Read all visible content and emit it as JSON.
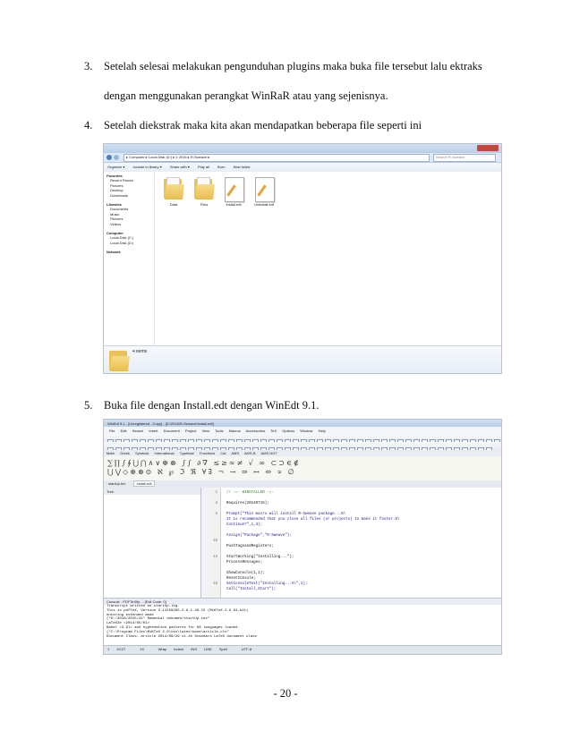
{
  "paragraphs": [
    {
      "num": "3.",
      "text": "Setelah selesai melakukan pengunduhan plugins maka buka file tersebut lalu ektraks"
    },
    {
      "num": "",
      "text": "dengan menggunakan perangkat WinRaR atau yang sejenisnya."
    },
    {
      "num": "4.",
      "text": "Setelah diekstrak maka kita akan mendapatkan beberapa file seperti ini"
    },
    {
      "num": "5.",
      "text": "Buka file dengan Install.edt dengan WinEdt 9.1."
    }
  ],
  "explorer": {
    "address": "▸ Computer ▸ Local Disk (D:) ▸ 0 2016 ▸ R-Sweave ▸",
    "search_placeholder": "Search R-Sweave",
    "toolbar": [
      "Organize ▾",
      "Include in library ▾",
      "Share with ▾",
      "Play all",
      "Burn",
      "New folder"
    ],
    "nav": [
      "Favorites",
      "Recent Places",
      "Pictures",
      "Desktop",
      "Downloads",
      "",
      "Libraries",
      "Documents",
      "Music",
      "Pictures",
      "Videos",
      "",
      "Computer",
      "Local Disk (C:)",
      "Local Disk (D:)",
      "",
      "Network"
    ],
    "items": [
      "Data",
      "Files",
      "Install.edt",
      "Uninstall.edt"
    ],
    "status": "4 items"
  },
  "winedt": {
    "title": "WinEdt 9.1 - [Unregistered - Copy] - [D:\\2016\\R-Sweave\\Install.edt]",
    "menu": [
      "File",
      "Edit",
      "Search",
      "Insert",
      "Document",
      "Project",
      "View",
      "Tools",
      "Macros",
      "Accessories",
      "TeX",
      "Options",
      "Window",
      "Help"
    ],
    "gui_tabs": [
      "Math",
      "Greek",
      "Symbols",
      "International",
      "Typeface",
      "Functions",
      "Cal",
      "AMS",
      "AMS-B",
      "AMS NOT"
    ],
    "doc_tabs": [
      "startUp.tex",
      "Install.edt"
    ],
    "tree_label": "Tree",
    "line_numbers": [
      "1",
      "",
      "3",
      "",
      "5",
      "",
      "",
      "",
      "",
      "10",
      "",
      "",
      "13",
      "",
      "",
      "",
      "",
      "18",
      ""
    ],
    "code": [
      {
        "t": "// -=- WINSTALLER -=-",
        "c": "g"
      },
      {
        "t": "",
        "c": "k"
      },
      {
        "t": "Requires(20140715);",
        "c": "k"
      },
      {
        "t": "",
        "c": "k"
      },
      {
        "t": "Prompt(\"This macro will install R-Sweave package...%\\",
        "c": ""
      },
      {
        "t": "It is recommended that you close all files (or projects) to make it faster.%\\",
        "c": ""
      },
      {
        "t": "Continue?\",1,3);",
        "c": ""
      },
      {
        "t": "",
        "c": "k"
      },
      {
        "t": "Assign(\"Package\",\"R-Sweave\");",
        "c": ""
      },
      {
        "t": "",
        "c": "k"
      },
      {
        "t": "PushTagsandRegisters;",
        "c": "k"
      },
      {
        "t": "",
        "c": "k"
      },
      {
        "t": "StartWorking(\"Installing...\");",
        "c": "k"
      },
      {
        "t": "ProcessMessages;",
        "c": "k"
      },
      {
        "t": "",
        "c": "k"
      },
      {
        "t": "ShowConsole(1,1);",
        "c": "k"
      },
      {
        "t": "ResetConsole;",
        "c": "k"
      },
      {
        "t": "SetConsoleText(\"Installing...%\\\",1);",
        "c": ""
      },
      {
        "t": "Call(\"Install_Start\");",
        "c": ""
      }
    ],
    "console_title": "Console - PDFTeXify ... [Exit Code: 0]",
    "console": [
      "Transcript written on startUp.log.",
      "This is pdfTeX, Version 3.14159265-2.6-1.40.15 (MiKTeX 2.9 64-bit)",
      "entering extended mode",
      "(\"D:/2016/2015/21\" Remedial dokumen/startUp.tex\"",
      "LaTeX2e <2014/05/01>",
      "Babel <3.9l> and hyphenation patterns for 68 languages loaded.",
      "(\"C:\\Program Files\\MiKTeX 2.9\\tex\\latex\\base\\article.cls\"",
      "Document Class: article 2014/09/29 v1.4h Standard LaTeX document class"
    ],
    "status": [
      "1",
      "10:27",
      "",
      "19",
      "",
      "Wrap",
      "Indent",
      "INS",
      "LINE",
      "Spell",
      "",
      "UTF-8"
    ]
  },
  "footer": "- 20 -"
}
